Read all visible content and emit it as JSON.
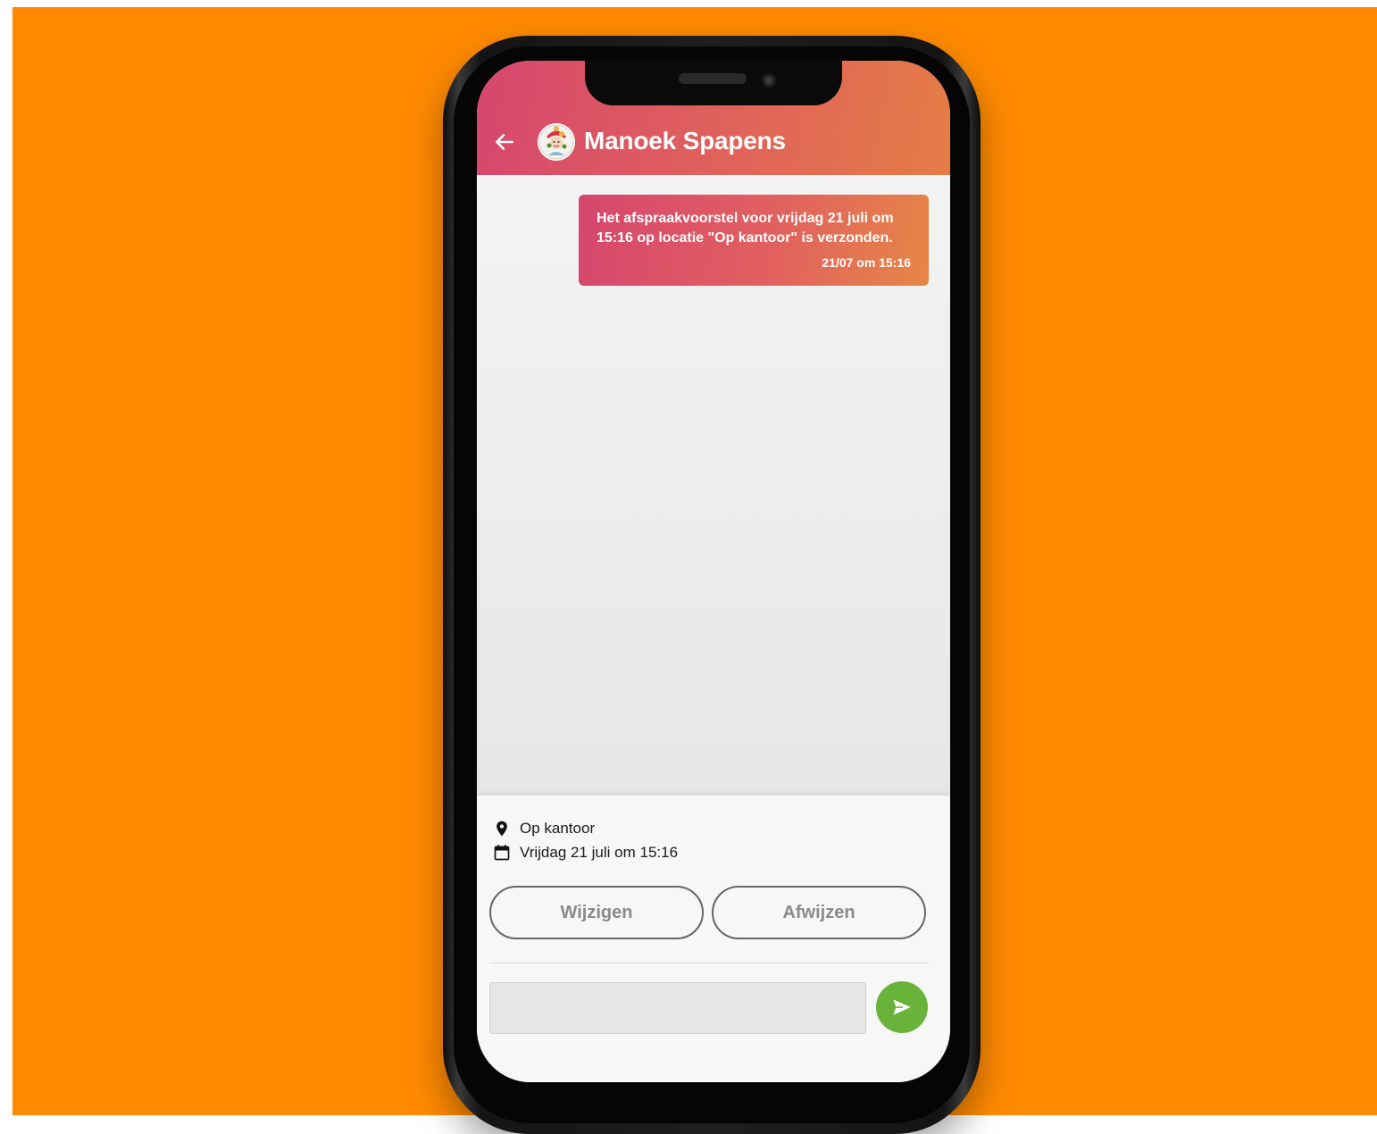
{
  "header": {
    "contact_name": "Manoek Spapens",
    "back_icon": "arrow-left-icon",
    "avatar_icon": "avatar-icon"
  },
  "conversation": {
    "messages": [
      {
        "text": "Het afspraakvoorstel voor vrijdag 21 juli om 15:16 op locatie \"Op kantoor\" is verzonden.",
        "time": "21/07 om 15:16",
        "direction": "outgoing"
      }
    ]
  },
  "appointment": {
    "location": "Op kantoor",
    "location_icon": "map-pin-icon",
    "datetime": "Vrijdag 21 juli om 15:16",
    "datetime_icon": "calendar-icon"
  },
  "actions": {
    "change_label": "Wijzigen",
    "decline_label": "Afwijzen"
  },
  "composer": {
    "placeholder": "",
    "value": "",
    "send_icon": "send-icon"
  },
  "colors": {
    "background": "#ff8a00",
    "header_gradient_start": "#d6466e",
    "header_gradient_end": "#e57c45",
    "send_button": "#6ab33a"
  }
}
